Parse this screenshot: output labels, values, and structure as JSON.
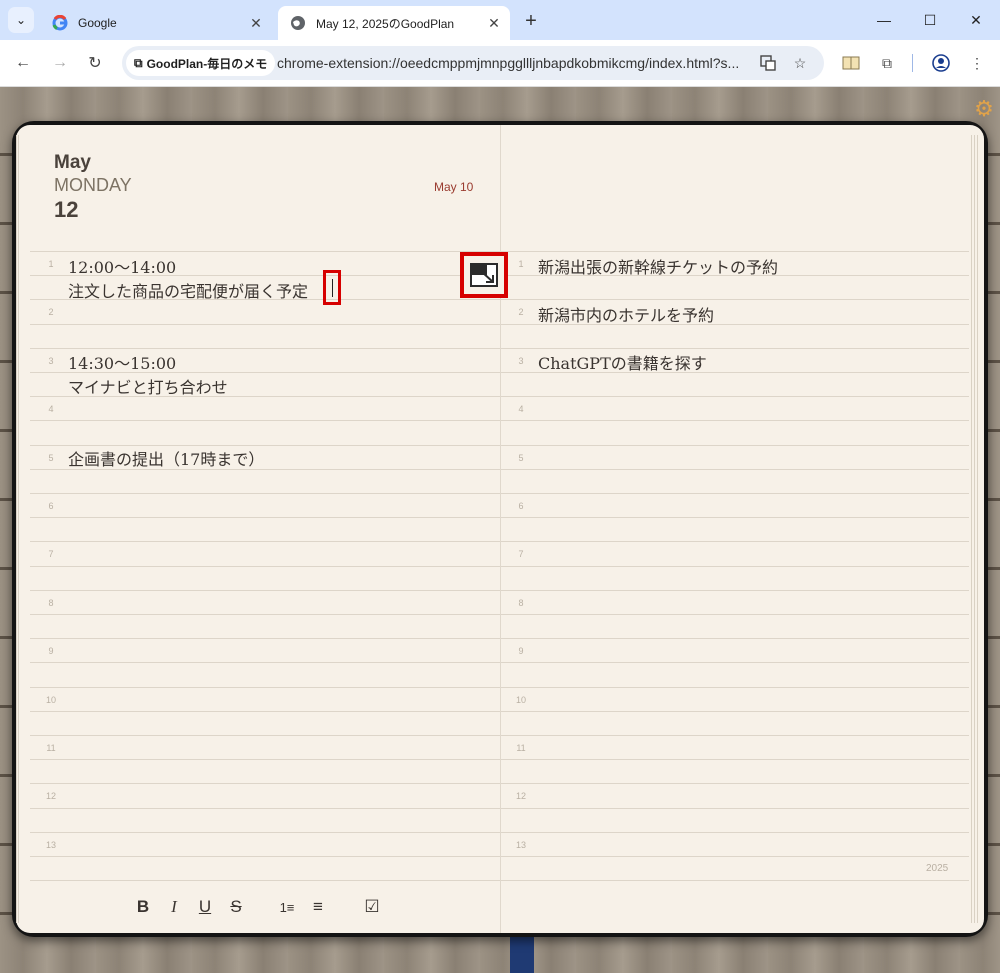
{
  "browser": {
    "tabs": [
      {
        "title": "Google",
        "active": false,
        "icon": "google-g-icon"
      },
      {
        "title": "May 12, 2025のGoodPlan",
        "active": true,
        "icon": "globe-icon"
      }
    ],
    "site_chip": "GoodPlan-毎日のメモ",
    "url": "chrome-extension://oeedcmppmjmnpggllljnbapdkobmikcmg/index.html?s..."
  },
  "notebook": {
    "header": {
      "month": "May",
      "weekday": "MONDAY",
      "day": "12",
      "date_link": "May 10"
    },
    "line_numbers": [
      "1",
      "2",
      "3",
      "4",
      "5",
      "6",
      "7",
      "8",
      "9",
      "10",
      "11",
      "12",
      "13"
    ],
    "left_entries": [
      "12:00〜14:00",
      "注文した商品の宅配便が届く予定",
      "14:30〜15:00",
      "マイナビと打ち合わせ",
      "企画書の提出（17時まで）"
    ],
    "right_entries": [
      "新潟出張の新幹線チケットの予約",
      "新潟市内のホテルを予約",
      "ChatGPTの書籍を探す"
    ],
    "year": "2025",
    "format_toolbar": [
      "B",
      "I",
      "U",
      "S",
      "1≡",
      "≡",
      "☑"
    ]
  },
  "colors": {
    "accent_red": "#d60000",
    "paper": "#f7f1e8",
    "date_link": "#9a3b2f",
    "ribbon": "#1f3a73"
  }
}
